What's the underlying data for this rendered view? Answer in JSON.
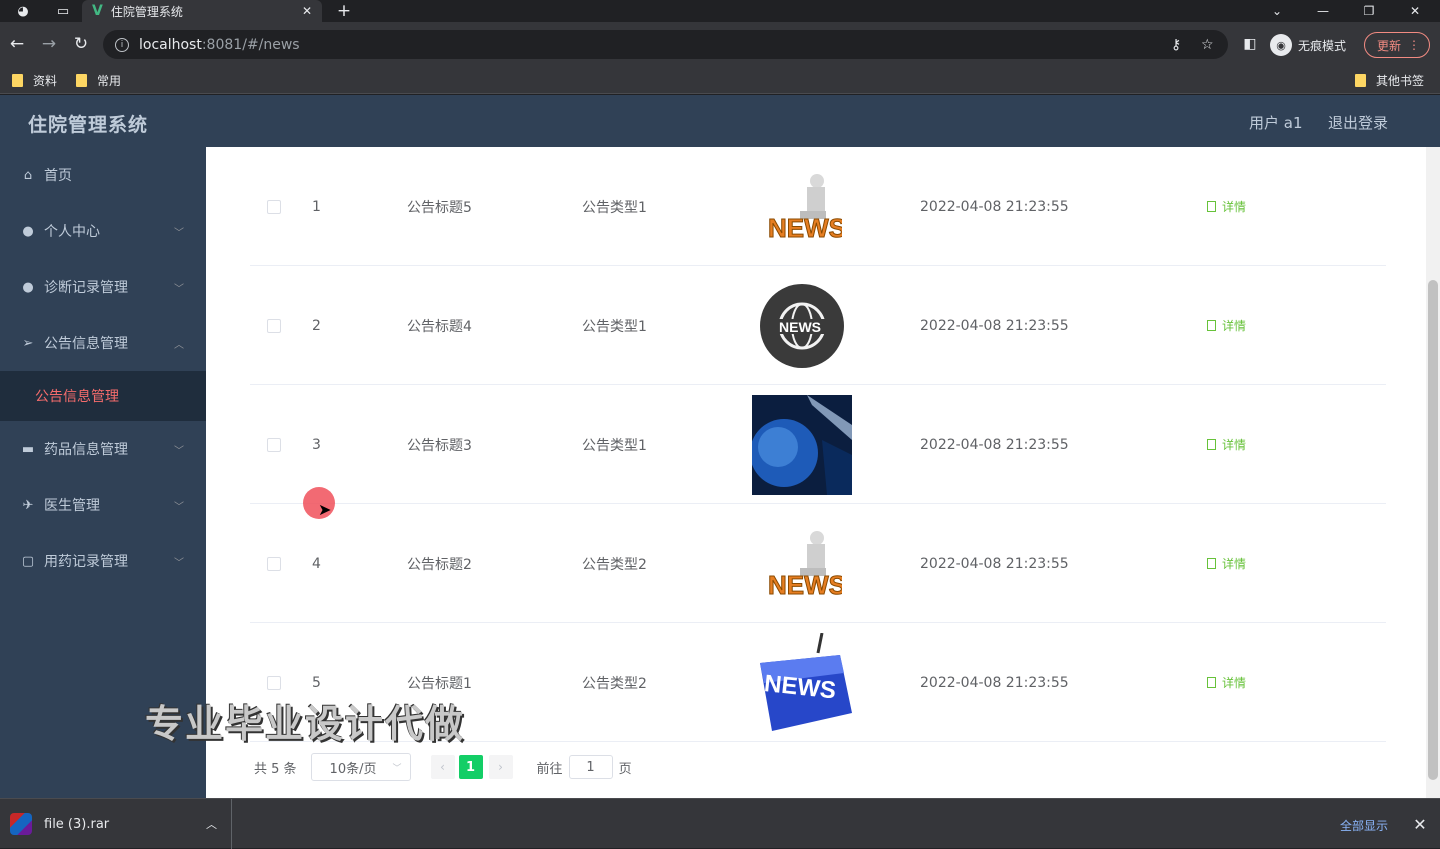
{
  "browser": {
    "tab_title": "住院管理系统",
    "tab_icon_glyph": "V",
    "url_host": "localhost",
    "url_rest": ":8081/#/news",
    "incognito_label": "无痕模式",
    "update_label": "更新",
    "bookmarks": [
      "资料",
      "常用"
    ],
    "other_bookmarks": "其他书签"
  },
  "header": {
    "title": "住院管理系统",
    "user": "用户 a1",
    "logout": "退出登录"
  },
  "sidebar": {
    "items": [
      {
        "label": "首页",
        "icon": "home-icon"
      },
      {
        "label": "个人中心",
        "icon": "user-icon"
      },
      {
        "label": "诊断记录管理",
        "icon": "user-icon"
      },
      {
        "label": "公告信息管理",
        "icon": "send-icon"
      },
      {
        "label": "药品信息管理",
        "icon": "suitcase-icon"
      },
      {
        "label": "医生管理",
        "icon": "plane-icon"
      },
      {
        "label": "用药记录管理",
        "icon": "chat-icon"
      }
    ],
    "active_sub": "公告信息管理"
  },
  "table": {
    "detail_label": "详情",
    "rows": [
      {
        "index": "1",
        "title": "公告标题5",
        "type": "公告类型1",
        "image": "news-figure-image",
        "time": "2022-04-08 21:23:55"
      },
      {
        "index": "2",
        "title": "公告标题4",
        "type": "公告类型1",
        "image": "news-globe-badge-image",
        "time": "2022-04-08 21:23:55"
      },
      {
        "index": "3",
        "title": "公告标题3",
        "type": "公告类型1",
        "image": "blue-globe-image",
        "time": "2022-04-08 21:23:55"
      },
      {
        "index": "4",
        "title": "公告标题2",
        "type": "公告类型2",
        "image": "news-figure-image",
        "time": "2022-04-08 21:23:55"
      },
      {
        "index": "5",
        "title": "公告标题1",
        "type": "公告类型2",
        "image": "news-key-image",
        "time": "2022-04-08 21:23:55"
      }
    ]
  },
  "pagination": {
    "total": "共 5 条",
    "page_size": "10条/页",
    "current_page": "1",
    "goto_label": "前往",
    "goto_value": "1",
    "page_unit": "页"
  },
  "overlay": {
    "watermark": "专业毕业设计代做"
  },
  "downloads": {
    "file_name": "file (3).rar",
    "show_all": "全部显示"
  },
  "colors": {
    "sidebar_bg": "#304156",
    "active_menu": "#f56c6c",
    "detail_green": "#67c23a",
    "pager_active": "#13ce66"
  }
}
